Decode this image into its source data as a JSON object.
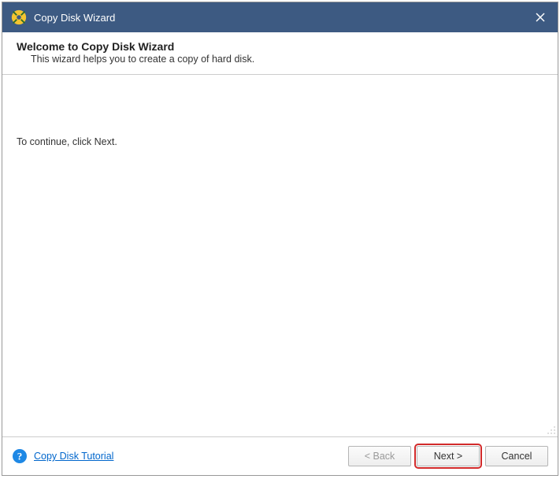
{
  "titlebar": {
    "title": "Copy Disk Wizard"
  },
  "header": {
    "heading": "Welcome to Copy Disk Wizard",
    "subtext": "This wizard helps you to create a copy of hard disk."
  },
  "body": {
    "instruction": "To continue, click Next."
  },
  "footer": {
    "tutorial_link": "Copy Disk Tutorial",
    "back_label": "< Back",
    "next_label": "Next >",
    "cancel_label": "Cancel"
  }
}
